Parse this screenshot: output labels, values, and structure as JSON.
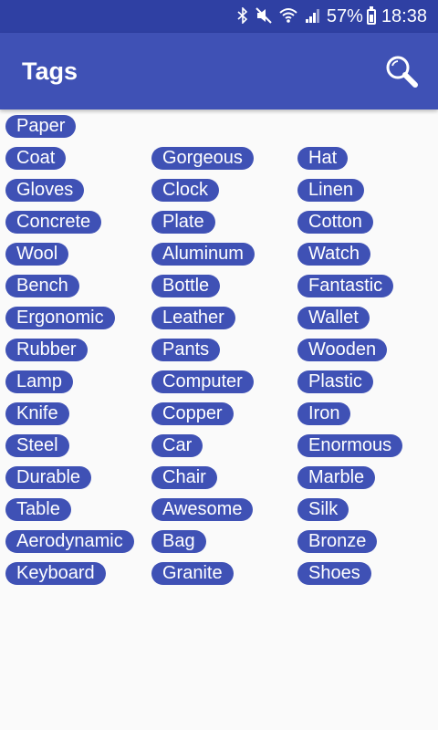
{
  "colors": {
    "status_bar": "#2f40a3",
    "app_bar": "#3f51b5",
    "tag_bg": "#3f51b5",
    "tag_text": "#ffffff",
    "background": "#fafafa"
  },
  "status_bar": {
    "icons": [
      "bluetooth-icon",
      "mute-icon",
      "wifi-icon",
      "signal-icon",
      "battery-charging-icon"
    ],
    "battery": "57%",
    "time": "18:38"
  },
  "app_bar": {
    "title": "Tags",
    "search_icon": "search-icon"
  },
  "tags": [
    [
      "Paper"
    ],
    [
      "Coat",
      "Gorgeous",
      "Hat"
    ],
    [
      "Gloves",
      "Clock",
      "Linen"
    ],
    [
      "Concrete",
      "Plate",
      "Cotton"
    ],
    [
      "Wool",
      "Aluminum",
      "Watch"
    ],
    [
      "Bench",
      "Bottle",
      "Fantastic"
    ],
    [
      "Ergonomic",
      "Leather",
      "Wallet"
    ],
    [
      "Rubber",
      "Pants",
      "Wooden"
    ],
    [
      "Lamp",
      "Computer",
      "Plastic"
    ],
    [
      "Knife",
      "Copper",
      "Iron"
    ],
    [
      "Steel",
      "Car",
      "Enormous"
    ],
    [
      "Durable",
      "Chair",
      "Marble"
    ],
    [
      "Table",
      "Awesome",
      "Silk"
    ],
    [
      "Aerodynamic",
      "Bag",
      "Bronze"
    ],
    [
      "Keyboard",
      "Granite",
      "Shoes"
    ]
  ]
}
